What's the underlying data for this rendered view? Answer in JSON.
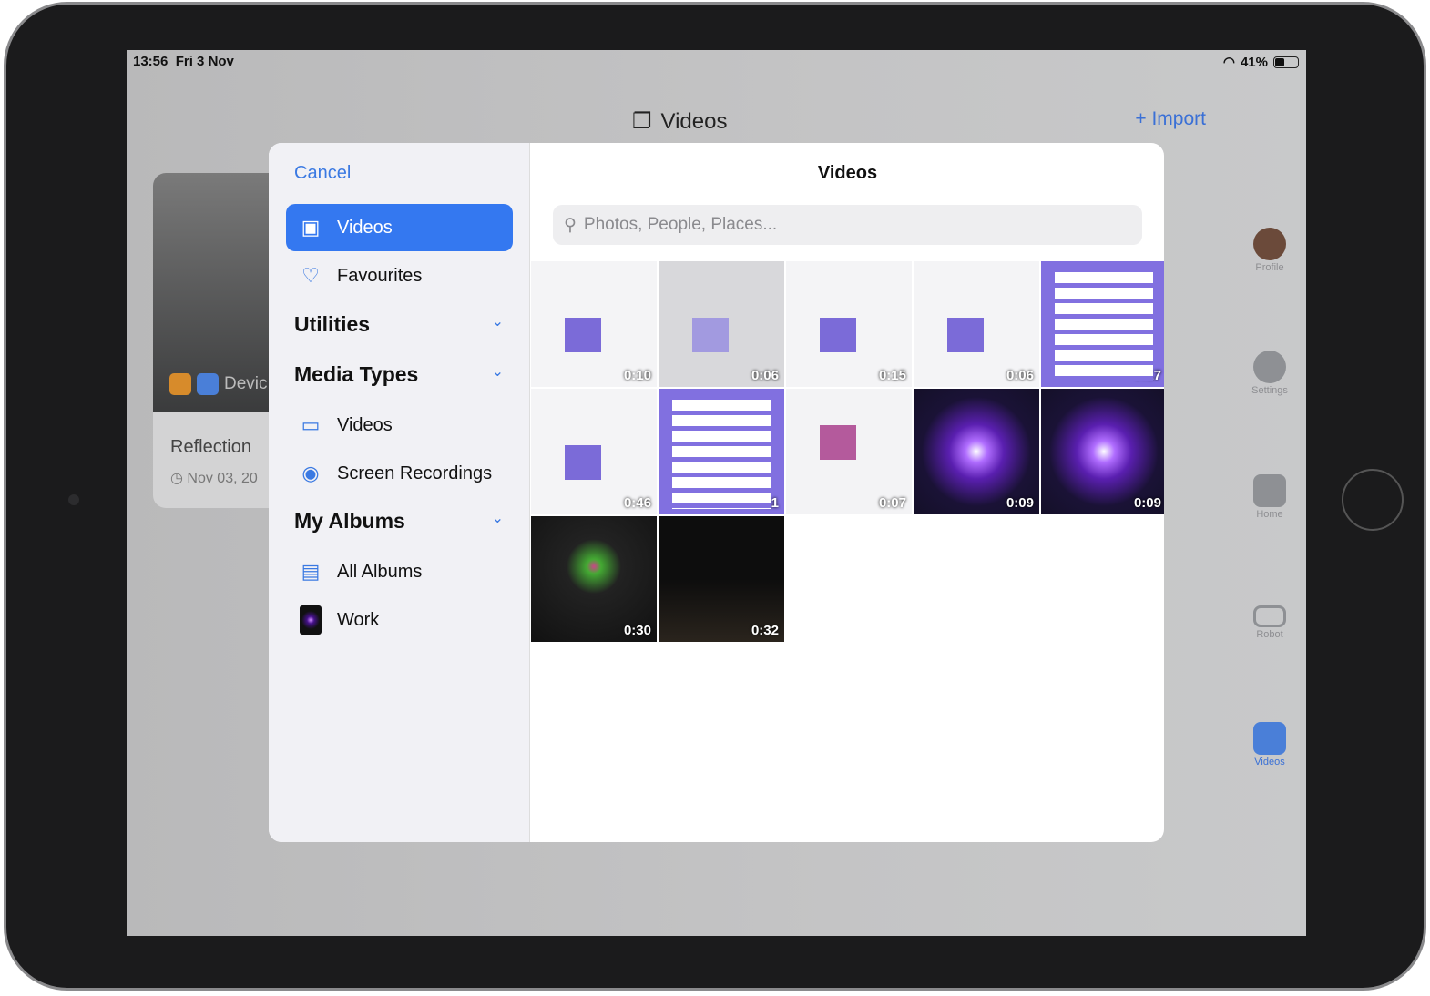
{
  "status": {
    "time": "13:56",
    "date": "Fri 3 Nov",
    "battery": "41%",
    "battery_level": 0.41
  },
  "header": {
    "title": "Videos",
    "import_label": "+ Import"
  },
  "background_card": {
    "badge_label": "Devic",
    "name": "Reflection",
    "date": "Nov 03, 20"
  },
  "rail": [
    {
      "label": "Profile"
    },
    {
      "label": "Settings"
    },
    {
      "label": "Home"
    },
    {
      "label": "Robot"
    },
    {
      "label": "Videos"
    }
  ],
  "picker": {
    "cancel_label": "Cancel",
    "title": "Videos",
    "search_placeholder": "Photos, People, Places...",
    "sidebar": {
      "videos": "Videos",
      "favourites": "Favourites",
      "utilities": "Utilities",
      "media_types": "Media Types",
      "media_videos": "Videos",
      "screen_recordings": "Screen Recordings",
      "my_albums": "My Albums",
      "all_albums": "All Albums",
      "work": "Work"
    },
    "items": [
      {
        "duration": "0:10",
        "style": "t-light"
      },
      {
        "duration": "0:06",
        "style": "t-grey"
      },
      {
        "duration": "0:15",
        "style": "t-light"
      },
      {
        "duration": "0:06",
        "style": "t-light"
      },
      {
        "duration": "0:17",
        "style": "t-purple"
      },
      {
        "duration": "0:46",
        "style": "t-light"
      },
      {
        "duration": "0:11",
        "style": "t-purple"
      },
      {
        "duration": "0:07",
        "style": "t-pink"
      },
      {
        "duration": "0:09",
        "style": "t-dark"
      },
      {
        "duration": "0:09",
        "style": "t-dark"
      },
      {
        "duration": "0:30",
        "style": "t-night"
      },
      {
        "duration": "0:32",
        "style": "t-night2"
      }
    ]
  },
  "colors": {
    "accent": "#3478f0"
  }
}
